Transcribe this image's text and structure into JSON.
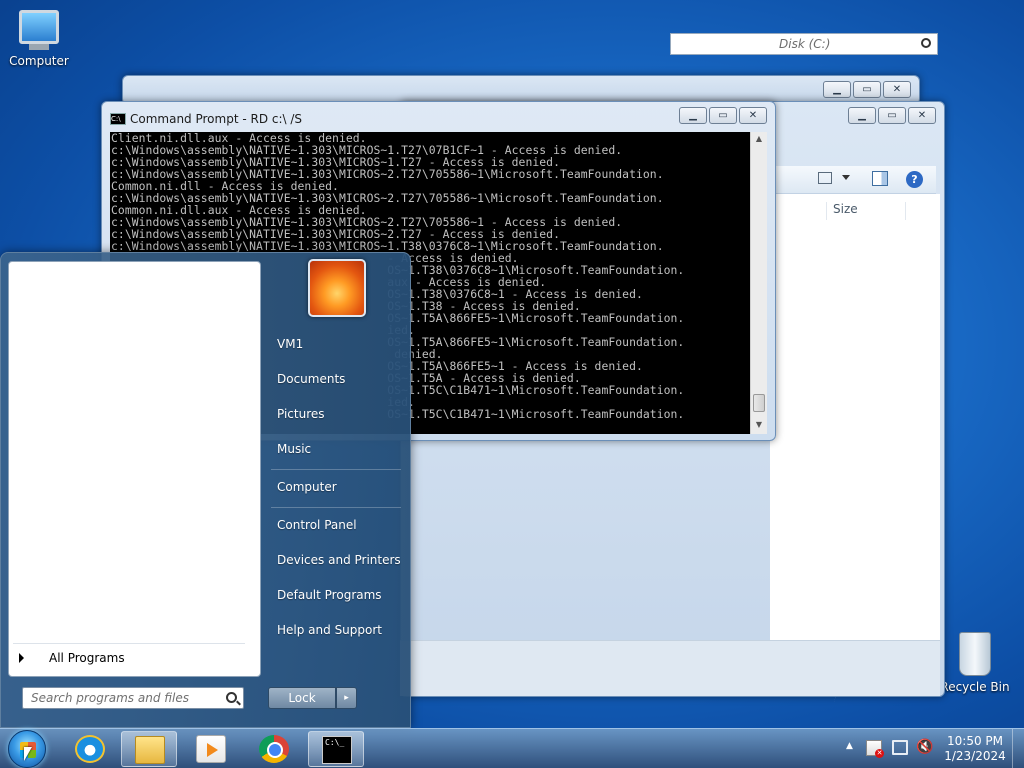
{
  "desktop": {
    "icons": [
      {
        "label": "Computer"
      },
      {
        "label": "Recycle Bin"
      }
    ]
  },
  "explorer": {
    "address": "Disk (C:)",
    "column_size": "Size"
  },
  "cmd": {
    "title": "Command Prompt - RD  c:\\ /S",
    "lines": [
      "Client.ni.dll.aux - Access is denied.",
      "c:\\Windows\\assembly\\NATIVE~1.303\\MICROS~1.T27\\07B1CF~1 - Access is denied.",
      "c:\\Windows\\assembly\\NATIVE~1.303\\MICROS~1.T27 - Access is denied.",
      "c:\\Windows\\assembly\\NATIVE~1.303\\MICROS~2.T27\\705586~1\\Microsoft.TeamFoundation.",
      "Common.ni.dll - Access is denied.",
      "c:\\Windows\\assembly\\NATIVE~1.303\\MICROS~2.T27\\705586~1\\Microsoft.TeamFoundation.",
      "Common.ni.dll.aux - Access is denied.",
      "c:\\Windows\\assembly\\NATIVE~1.303\\MICROS~2.T27\\705586~1 - Access is denied.",
      "c:\\Windows\\assembly\\NATIVE~1.303\\MICROS~2.T27 - Access is denied.",
      "c:\\Windows\\assembly\\NATIVE~1.303\\MICROS~1.T38\\0376C8~1\\Microsoft.TeamFoundation.",
      "                                        - Access is denied.",
      "                                        OS~1.T38\\0376C8~1\\Microsoft.TeamFoundation.",
      "                                        aux - Access is denied.",
      "                                        OS~1.T38\\0376C8~1 - Access is denied.",
      "                                        OS~1.T38 - Access is denied.",
      "                                        OS~1.T5A\\866FE5~1\\Microsoft.TeamFoundation.",
      "                                        ied.",
      "                                        OS~1.T5A\\866FE5~1\\Microsoft.TeamFoundation.",
      "                                         denied.",
      "                                        OS~1.T5A\\866FE5~1 - Access is denied.",
      "                                        OS~1.T5A - Access is denied.",
      "                                        OS~1.T5C\\C1B471~1\\Microsoft.TeamFoundation.",
      "                                        ied.",
      "                                        OS~1.T5C\\C1B471~1\\Microsoft.TeamFoundation."
    ]
  },
  "start_menu": {
    "user": "VM1",
    "right_items": [
      "Documents",
      "Pictures",
      "Music",
      "Computer",
      "Control Panel",
      "Devices and Printers",
      "Default Programs",
      "Help and Support"
    ],
    "all_programs": "All Programs",
    "search_placeholder": "Search programs and files",
    "lock_label": "Lock",
    "lock_arrow": "▸"
  },
  "window_buttons": {
    "minimize": "▁",
    "maximize": "▭",
    "close": "✕"
  },
  "taskbar": {
    "time": "10:50 PM",
    "date": "1/23/2024",
    "tray_chevron": "▲",
    "cmd_glyph": "C:\\_"
  }
}
